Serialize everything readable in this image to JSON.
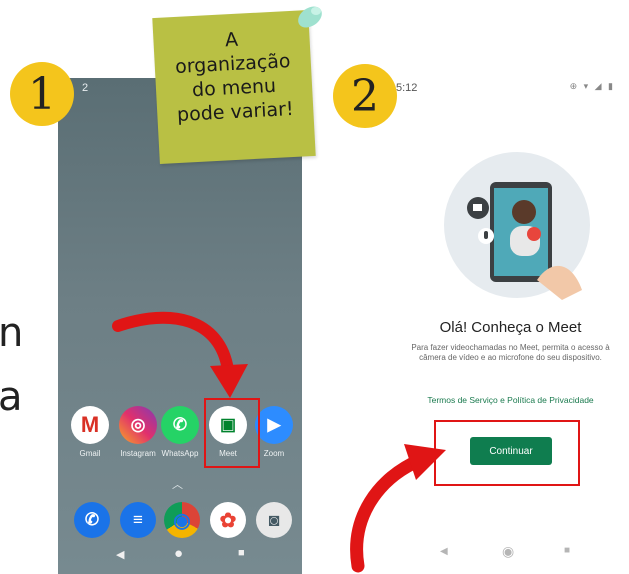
{
  "edge_text": {
    "line1": "n",
    "line2": "a"
  },
  "note": {
    "lines": [
      "A",
      "organização",
      "do menu",
      "pode variar!"
    ]
  },
  "badges": {
    "step1": "1",
    "step2": "2"
  },
  "phone1": {
    "time": "2",
    "apps": [
      {
        "label": "Gmail",
        "glyph": "M",
        "color": "#ffffff",
        "fg": "#d93025"
      },
      {
        "label": "Instagram",
        "glyph": "◎",
        "color": "#c13584",
        "fg": "#ffffff"
      },
      {
        "label": "WhatsApp",
        "glyph": "✆",
        "color": "#25d366",
        "fg": "#ffffff"
      },
      {
        "label": "Meet",
        "glyph": "▣",
        "color": "#ffffff",
        "fg": "#00832d"
      },
      {
        "label": "Zoom",
        "glyph": "▶",
        "color": "#2d8cff",
        "fg": "#ffffff"
      }
    ],
    "dock": [
      {
        "name": "phone-icon",
        "glyph": "✆",
        "color": "#1a73e8"
      },
      {
        "name": "messages-icon",
        "glyph": "≡",
        "color": "#1a73e8"
      },
      {
        "name": "chrome-icon",
        "glyph": "◉",
        "color": "#f2a600"
      },
      {
        "name": "photos-icon",
        "glyph": "✿",
        "color": "#ffffff"
      },
      {
        "name": "camera-icon",
        "glyph": "◙",
        "color": "#e8e8e8"
      }
    ],
    "nav": {
      "back": "◀",
      "home": "●",
      "recents": "■"
    }
  },
  "phone2": {
    "time": "5:12",
    "status": "⊕ ▾ ◢ ▮",
    "welcome_title": "Olá! Conheça o Meet",
    "description": "Para fazer videochamadas no Meet, permita o acesso à câmera de vídeo e ao microfone do seu dispositivo.",
    "terms_link": "Termos de Serviço e Política de Privacidade",
    "continue_button": "Continuar",
    "nav": {
      "back": "◀",
      "home": "◉",
      "recents": "■"
    }
  },
  "colors": {
    "accent_red": "#e01515",
    "meet_green": "#0f7d4f",
    "note": "#b9c044",
    "badge": "#f4c51c"
  }
}
